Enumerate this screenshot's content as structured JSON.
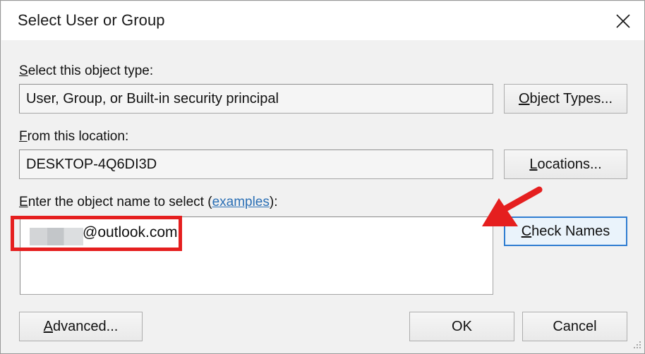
{
  "window": {
    "title": "Select User or Group",
    "close_icon": "close-icon"
  },
  "object_type": {
    "label_accel": "S",
    "label_rest": "elect this object type:",
    "value": "User, Group, or Built-in security principal",
    "button": {
      "accel": "O",
      "rest": "bject Types..."
    }
  },
  "location": {
    "label_accel": "F",
    "label_rest": "rom this location:",
    "value": "DESKTOP-4Q6DI3D",
    "button": {
      "accel": "L",
      "rest": "ocations..."
    }
  },
  "object_name": {
    "label_accel": "E",
    "label_mid": "nter the object name to select (",
    "label_link": "examples",
    "label_end": "):",
    "value": "@outlook.com",
    "redacted": true,
    "button": {
      "accel": "C",
      "rest": "heck Names"
    }
  },
  "footer": {
    "advanced": {
      "accel": "A",
      "rest": "dvanced..."
    },
    "ok": "OK",
    "cancel": "Cancel"
  },
  "annotations": {
    "arrow_color": "#e51f1f",
    "highlight_color": "#e51f1f",
    "arrow_target": "check-names-button",
    "highlight_target": "object-name-value"
  },
  "colors": {
    "dialog_bg": "#f1f1f1",
    "titlebar_bg": "#ffffff",
    "focus_blue": "#2f7dd1",
    "link_blue": "#2a6fb5"
  }
}
